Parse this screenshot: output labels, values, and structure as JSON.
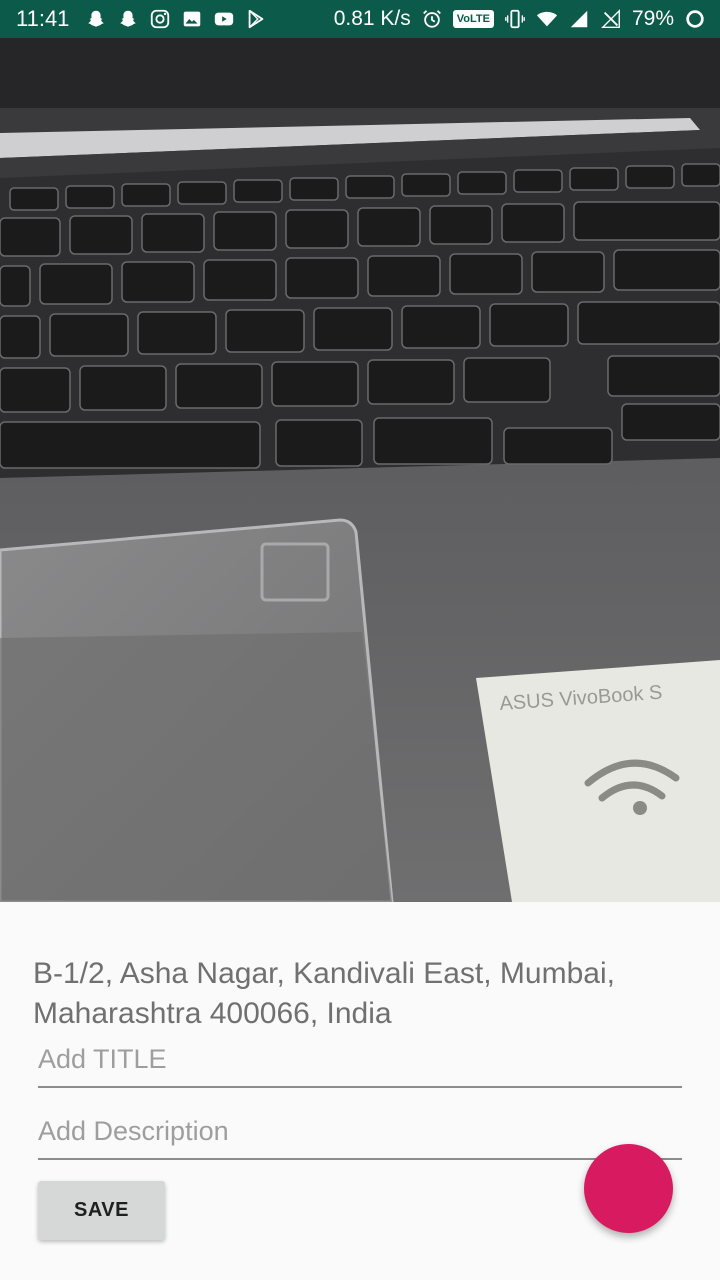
{
  "status_bar": {
    "time": "11:41",
    "net_speed": "0.81 K/s",
    "volte": "VoLTE",
    "battery": "79%",
    "left_icons": [
      "snapchat-icon",
      "snapchat-icon",
      "instagram-icon",
      "gallery-icon",
      "youtube-icon",
      "play-store-icon"
    ],
    "right_icons": [
      "alarm-icon",
      "volte-icon",
      "vibrate-icon",
      "wifi-icon",
      "signal-icon",
      "no-sim-icon",
      "battery-icon"
    ],
    "background": "#0b5a4a"
  },
  "photo": {
    "label_text": "ASUS VivoBook S"
  },
  "form": {
    "address": "B-1/2, Asha Nagar, Kandivali East, Mumbai, Maharashtra 400066, India",
    "title_placeholder": "Add TITLE",
    "title_value": "",
    "description_placeholder": "Add Description",
    "description_value": "",
    "save_label": "SAVE"
  },
  "fab": {
    "color": "#d81b60"
  }
}
